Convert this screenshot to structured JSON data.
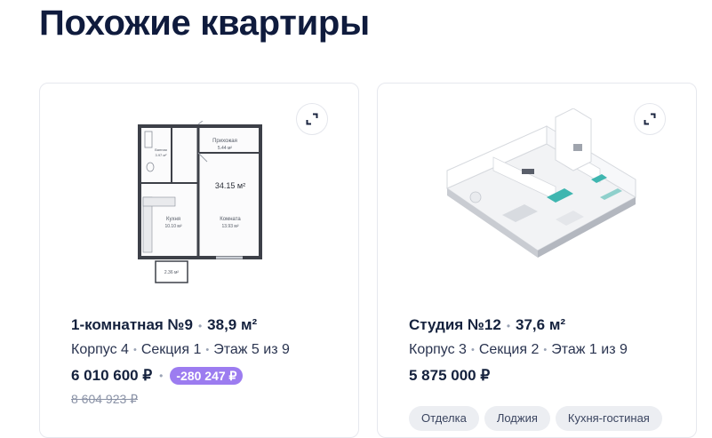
{
  "page": {
    "title": "Похожие квартиры"
  },
  "cards": [
    {
      "heading_type": "1-комнатная №9",
      "heading_area": "38,9 м²",
      "building": "Корпус 4",
      "section": "Секция 1",
      "floor": "Этаж 5 из 9",
      "price": "6 010 600 ₽",
      "discount": "-280 247 ₽",
      "old_price": "8 604 923 ₽",
      "plan_labels": {
        "hall": "Прихожая",
        "hall_area": "5.44 м²",
        "bath": "Ванная",
        "bath_area": "3.97 м²",
        "total_area": "34.15 м²",
        "kitchen": "Кухня",
        "kitchen_area": "10.10 м²",
        "room": "Комната",
        "room_area": "13.93 м²",
        "balcony_area": "2.36 м²"
      }
    },
    {
      "heading_type": "Студия №12",
      "heading_area": "37,6 м²",
      "building": "Корпус 3",
      "section": "Секция 2",
      "floor": "Этаж 1 из 9",
      "price": "5 875 000 ₽",
      "tags": [
        "Отделка",
        "Лоджия",
        "Кухня-гостиная"
      ]
    }
  ],
  "icons": {
    "expand": "expand-icon"
  }
}
